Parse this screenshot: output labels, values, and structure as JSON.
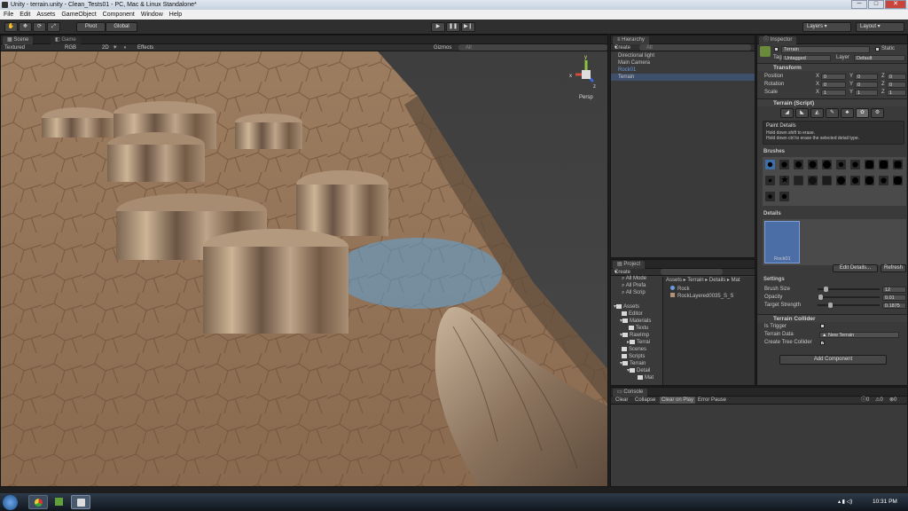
{
  "window": {
    "title": "Unity - terrain.unity - Clean_Tests01 - PC, Mac & Linux Standalone*"
  },
  "window_controls": {
    "minimize": "─",
    "maximize": "□",
    "close": "✕"
  },
  "menu": [
    "File",
    "Edit",
    "Assets",
    "GameObject",
    "Component",
    "Window",
    "Help"
  ],
  "toolbar": {
    "pivot": "Pivot",
    "global": "Global",
    "layers": "Layers",
    "layout": "Layout"
  },
  "scene": {
    "tab_scene": "Scene",
    "tab_game": "Game",
    "render_mode": "Textured",
    "color_mode": "RGB",
    "mode_2d": "2D",
    "effects": "Effects",
    "gizmos": "Gizmos",
    "search": "All",
    "persp": "Persp",
    "axis_y": "y",
    "axis_x": "x",
    "axis_z": "z"
  },
  "hierarchy": {
    "tab": "Hierarchy",
    "create": "Create",
    "search": "All",
    "items": [
      {
        "label": "Directional light"
      },
      {
        "label": "Main Camera"
      },
      {
        "label": "Rock01"
      },
      {
        "label": "Terrain"
      }
    ]
  },
  "project": {
    "tab": "Project",
    "create": "Create",
    "favorites": [
      "All Mode",
      "All Prefa",
      "All Scrip"
    ],
    "assets_root": "Assets",
    "tree": [
      "Editor",
      "Materials",
      "Textu",
      "RawImp",
      "Terrai",
      "Scenes",
      "Scripts",
      "Terrain",
      "Detail",
      "Mat"
    ],
    "breadcrumb": "Assets ▸ Terrain ▸ Details ▸ Mat",
    "files": [
      "Rock",
      "RockLayered0035_S_S"
    ]
  },
  "console": {
    "tab": "Console",
    "clear": "Clear",
    "collapse": "Collapse",
    "clear_on_play": "Clear on Play",
    "error_pause": "Error Pause",
    "count_error": "0",
    "count_warn": "0",
    "count_info": "0"
  },
  "inspector": {
    "tab": "Inspector",
    "object_name": "Terrain",
    "static": "Static",
    "tag_label": "Tag",
    "tag_value": "Untagged",
    "layer_label": "Layer",
    "layer_value": "Default",
    "transform": {
      "title": "Transform",
      "position": {
        "label": "Position",
        "x": "0",
        "y": "0",
        "z": "0"
      },
      "rotation": {
        "label": "Rotation",
        "x": "0",
        "y": "0",
        "z": "0"
      },
      "scale": {
        "label": "Scale",
        "x": "1",
        "y": "1",
        "z": "1"
      }
    },
    "terrain_script": {
      "title": "Terrain (Script)",
      "paint_details": "Paint Details",
      "help1": "Hold down shift to erase.",
      "help2": "Hold down ctrl to erase the selected detail type.",
      "brushes": "Brushes",
      "details": "Details",
      "detail_item": "Rock01",
      "edit_details": "Edit Details...",
      "refresh": "Refresh",
      "settings": "Settings",
      "brush_size": {
        "label": "Brush Size",
        "value": "12",
        "fraction": 0.1
      },
      "opacity": {
        "label": "Opacity",
        "value": "0.01",
        "fraction": 0.01
      },
      "target_strength": {
        "label": "Target Strength",
        "value": "0.1875",
        "fraction": 0.1875
      }
    },
    "terrain_collider": {
      "title": "Terrain Collider",
      "is_trigger": "Is Trigger",
      "terrain_data_label": "Terrain Data",
      "terrain_data_value": "New Terrain",
      "create_tree_collider": "Create Tree Collider"
    },
    "add_component": "Add Component"
  },
  "taskbar": {
    "time": "10:31 PM"
  },
  "colors": {
    "selection": "#3e4f6b",
    "accent": "#6c9be2",
    "panel": "#3a3a3a"
  }
}
